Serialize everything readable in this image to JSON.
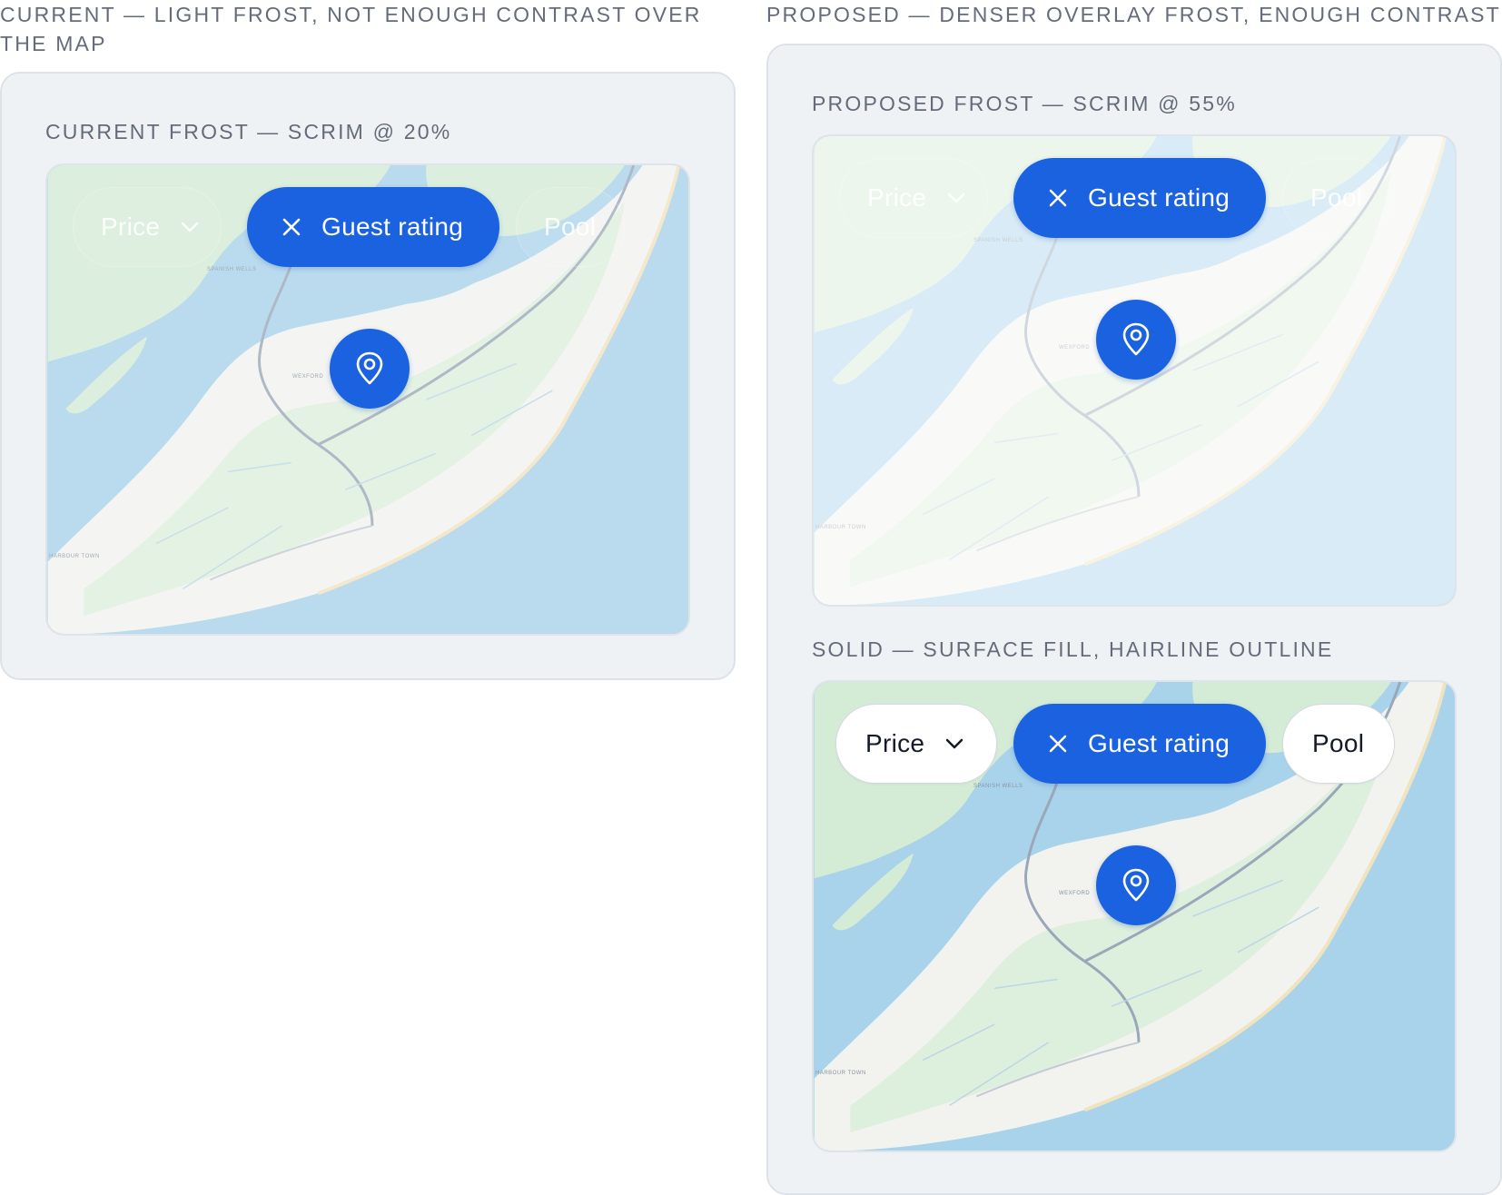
{
  "current": {
    "heading": "CURRENT — LIGHT FROST, NOT ENOUGH CONTRAST OVER THE MAP",
    "panel_title": "CURRENT FROST — SCRIM @ 20%",
    "scrim_opacity": 0.2,
    "chips": {
      "price": "Price",
      "guest_rating": "Guest rating",
      "pool": "Pool"
    }
  },
  "proposed": {
    "heading": "PROPOSED — DENSER OVERLAY FROST, ENOUGH CONTRAST",
    "frost": {
      "title": "PROPOSED FROST — SCRIM @ 55%",
      "scrim_opacity": 0.55,
      "chips": {
        "price": "Price",
        "guest_rating": "Guest rating",
        "pool": "Pool"
      }
    },
    "solid": {
      "title": "SOLID — SURFACE FILL, HAIRLINE OUTLINE",
      "chips": {
        "price": "Price",
        "guest_rating": "Guest rating",
        "pool": "Pool"
      }
    }
  },
  "map_labels": {
    "spanish_wells": "SPANISH WELLS",
    "wexford": "WEXFORD",
    "harbour_town": "HARBOUR TOWN"
  },
  "colors": {
    "water": "#a9d3ea",
    "land": "#f2f3ef",
    "marsh": "#d4ecd6",
    "accent": "#1a62e0",
    "panel": "#eff2f5",
    "heading_text": "#646b7a"
  },
  "icons": [
    "chevron-down-icon",
    "close-icon",
    "map-pin-icon"
  ]
}
